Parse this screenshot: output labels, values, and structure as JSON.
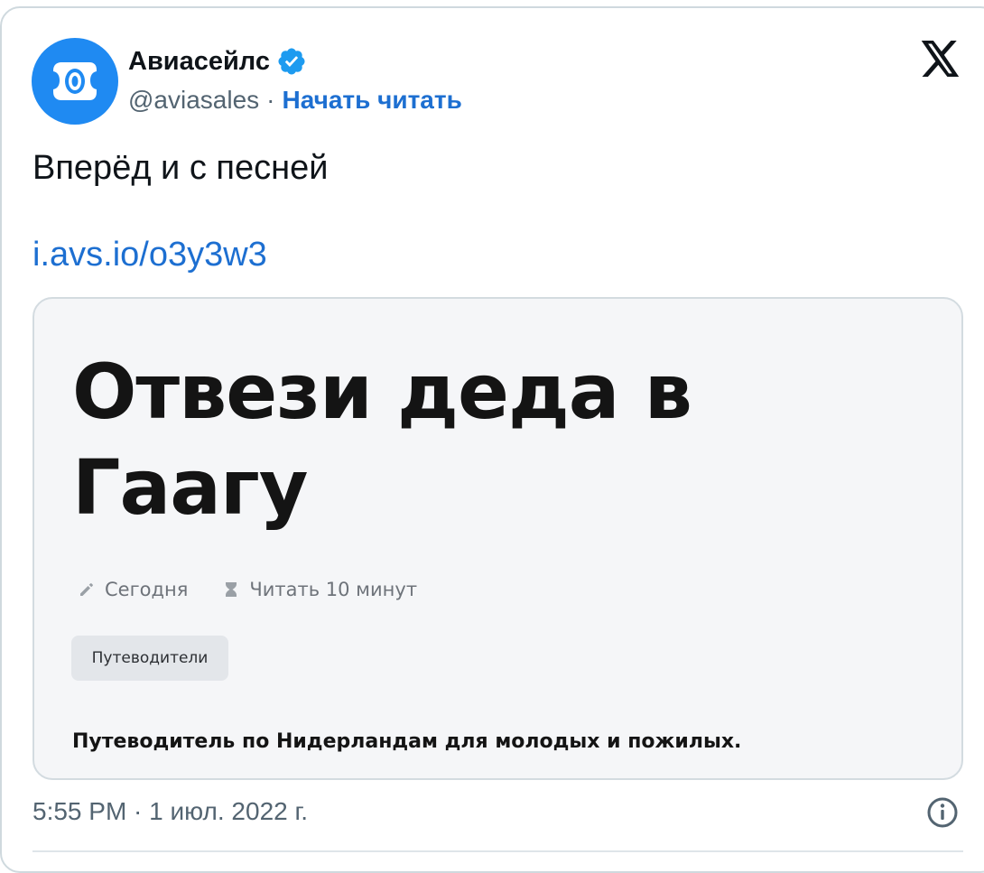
{
  "author": {
    "display_name": "Авиасейлс",
    "handle": "@aviasales",
    "separator": "·",
    "follow_label": "Начать читать",
    "verified": true
  },
  "tweet": {
    "text": "Вперёд и с песней",
    "link": "i.avs.io/o3y3w3"
  },
  "card": {
    "title": "Отвези деда в Гаагу",
    "date_label": "Сегодня",
    "read_time_label": "Читать 10 минут",
    "tag": "Путеводители",
    "description": "Путеводитель по Нидерландам для молодых и пожилых."
  },
  "footer": {
    "timestamp": "5:55 PM · 1 июл. 2022 г."
  },
  "icons": {
    "avatar": "aviasales-logo-icon",
    "verified": "verified-badge-icon",
    "brand": "x-logo-icon",
    "date": "pencil-icon",
    "read_time": "hourglass-icon",
    "info": "info-icon"
  },
  "colors": {
    "link": "#1d6fd1",
    "avatar_bg": "#1f8af2",
    "verified": "#1d9bf0",
    "card_bg": "#f5f6f8",
    "border": "#cfd9de"
  }
}
